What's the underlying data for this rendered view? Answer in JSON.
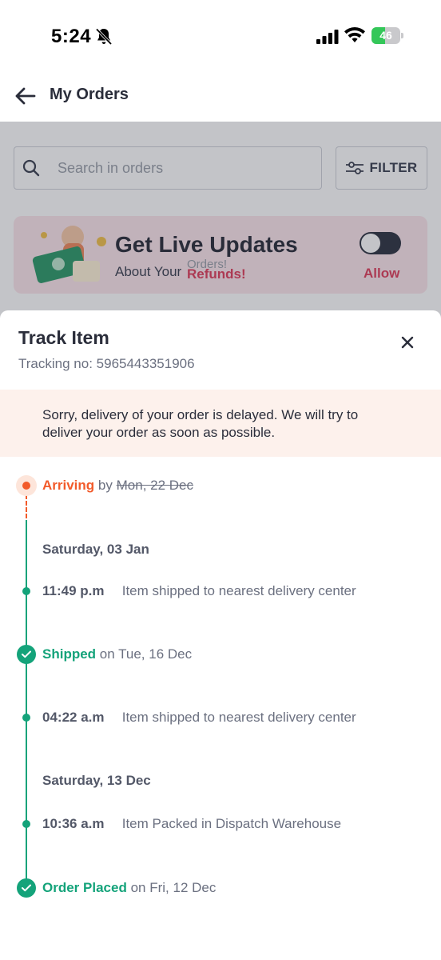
{
  "status_bar": {
    "time": "5:24",
    "battery_level": "46",
    "battery_fraction": 0.46,
    "icons": [
      "bell-slash-icon",
      "signal-icon",
      "wifi-icon",
      "battery-charging-icon"
    ]
  },
  "header": {
    "title": "My Orders",
    "back_icon": "arrow-left-icon"
  },
  "search": {
    "placeholder": "Search in orders",
    "icon": "search-icon"
  },
  "filter": {
    "label": "FILTER",
    "icon": "sliders-icon"
  },
  "promo": {
    "title": "Get Live Updates",
    "subtitle": "About Your",
    "subtitle_ghost": "Orders!",
    "subtitle_accent": "Refunds!",
    "toggle_on": false,
    "allow_label": "Allow"
  },
  "sheet": {
    "title": "Track Item",
    "tracking_label": "Tracking no:",
    "tracking_number": "5965443351906",
    "close_icon": "close-icon",
    "delay_message": "Sorry, delivery of your order is delayed. We will try to deliver your order as soon as possible."
  },
  "timeline": {
    "arriving": {
      "status": "Arriving",
      "connector": "by",
      "original_date": "Mon, 22 Dec"
    },
    "groups": [
      {
        "date": "Saturday, 03 Jan",
        "events": [
          {
            "time": "11:49 p.m",
            "text": "Item shipped to nearest delivery center"
          }
        ]
      },
      {
        "milestone": {
          "status": "Shipped",
          "connector": "on",
          "date": "Tue, 16 Dec"
        },
        "events": [
          {
            "time": "04:22 a.m",
            "text": "Item shipped to nearest delivery center"
          }
        ]
      },
      {
        "date": "Saturday, 13 Dec",
        "events": [
          {
            "time": "10:36 a.m",
            "text": "Item Packed in Dispatch Warehouse"
          }
        ]
      }
    ],
    "placed": {
      "status": "Order Placed",
      "connector": "on",
      "date": "Fri, 12 Dec"
    }
  },
  "colors": {
    "accent_green": "#14a37a",
    "accent_orange": "#f25a2a",
    "promo_pink": "#e0415e",
    "delay_banner_bg": "#fdf1ec"
  }
}
